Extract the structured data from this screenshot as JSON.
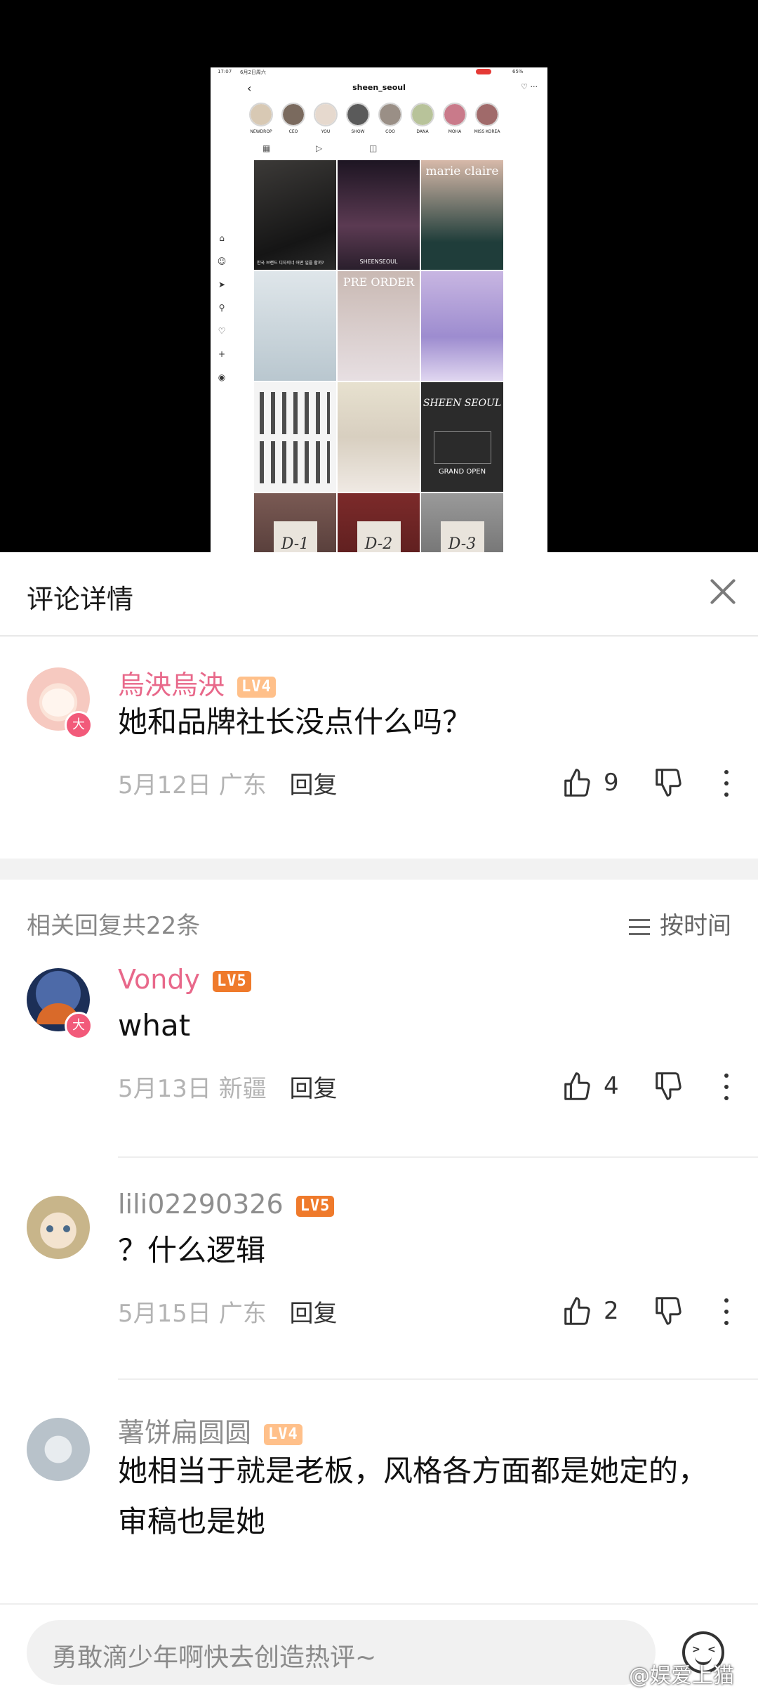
{
  "embedded_screenshot": {
    "status_time": "17:07",
    "status_date": "6月2日周六",
    "battery": "65%",
    "username": "sheen_seoul",
    "stories": [
      "NEWDROP",
      "CEO",
      "YOU",
      "SHOW",
      "COO",
      "DANA",
      "MOHA",
      "MISS KOREA"
    ],
    "posts": [
      {
        "caption": "한국 브랜드 디자이너 어떤 일을 할까?",
        "overlay": ""
      },
      {
        "caption": "",
        "overlay": "SHEENSEOUL"
      },
      {
        "caption": "",
        "overlay": "marie claire"
      },
      {
        "caption": "",
        "overlay": ""
      },
      {
        "caption": "",
        "overlay": "PRE ORDER"
      },
      {
        "caption": "",
        "overlay": ""
      },
      {
        "caption": "",
        "overlay": ""
      },
      {
        "caption": "",
        "overlay": ""
      },
      {
        "caption": "",
        "overlay": "SHEEN SEOUL"
      },
      {
        "caption": "",
        "overlay": "D-1"
      },
      {
        "caption": "",
        "overlay": "D-2"
      },
      {
        "caption": "",
        "overlay": "D-3"
      }
    ],
    "grand_open": "GRAND OPEN"
  },
  "sheet": {
    "title": "评论详情"
  },
  "main_comment": {
    "username": "烏泱烏泱",
    "level": "LV4",
    "badge": "大",
    "text": "她和品牌社长没点什么吗？",
    "date": "5月12日",
    "location": "广东",
    "reply_label": "回复",
    "likes": "9"
  },
  "replies_header": {
    "count_text": "相关回复共22条",
    "sort_label": "按时间"
  },
  "replies": [
    {
      "username": "Vondy",
      "level": "LV5",
      "badge": "大",
      "text": "what",
      "date": "5月13日",
      "location": "新疆",
      "reply_label": "回复",
      "likes": "4"
    },
    {
      "username": "lili02290326",
      "level": "LV5",
      "badge": "",
      "text": "？什么逻辑",
      "date": "5月15日",
      "location": "广东",
      "reply_label": "回复",
      "likes": "2"
    },
    {
      "username": "薯饼扁圆圆",
      "level": "LV4",
      "badge": "",
      "text": "她相当于就是老板，风格各方面都是她定的，审稿也是她",
      "date": "",
      "location": "",
      "reply_label": "",
      "likes": ""
    }
  ],
  "input": {
    "placeholder": "勇敢滴少年啊快去创造热评~"
  },
  "watermark": "@娱爱上猫",
  "icons": [
    "close-icon",
    "thumbs-up-icon",
    "thumbs-down-icon",
    "more-icon",
    "sort-icon",
    "emoji-icon"
  ],
  "colors": {
    "username_pink": "#e8688a",
    "lv4": "#ffc08a",
    "lv5": "#ef7a2b"
  }
}
